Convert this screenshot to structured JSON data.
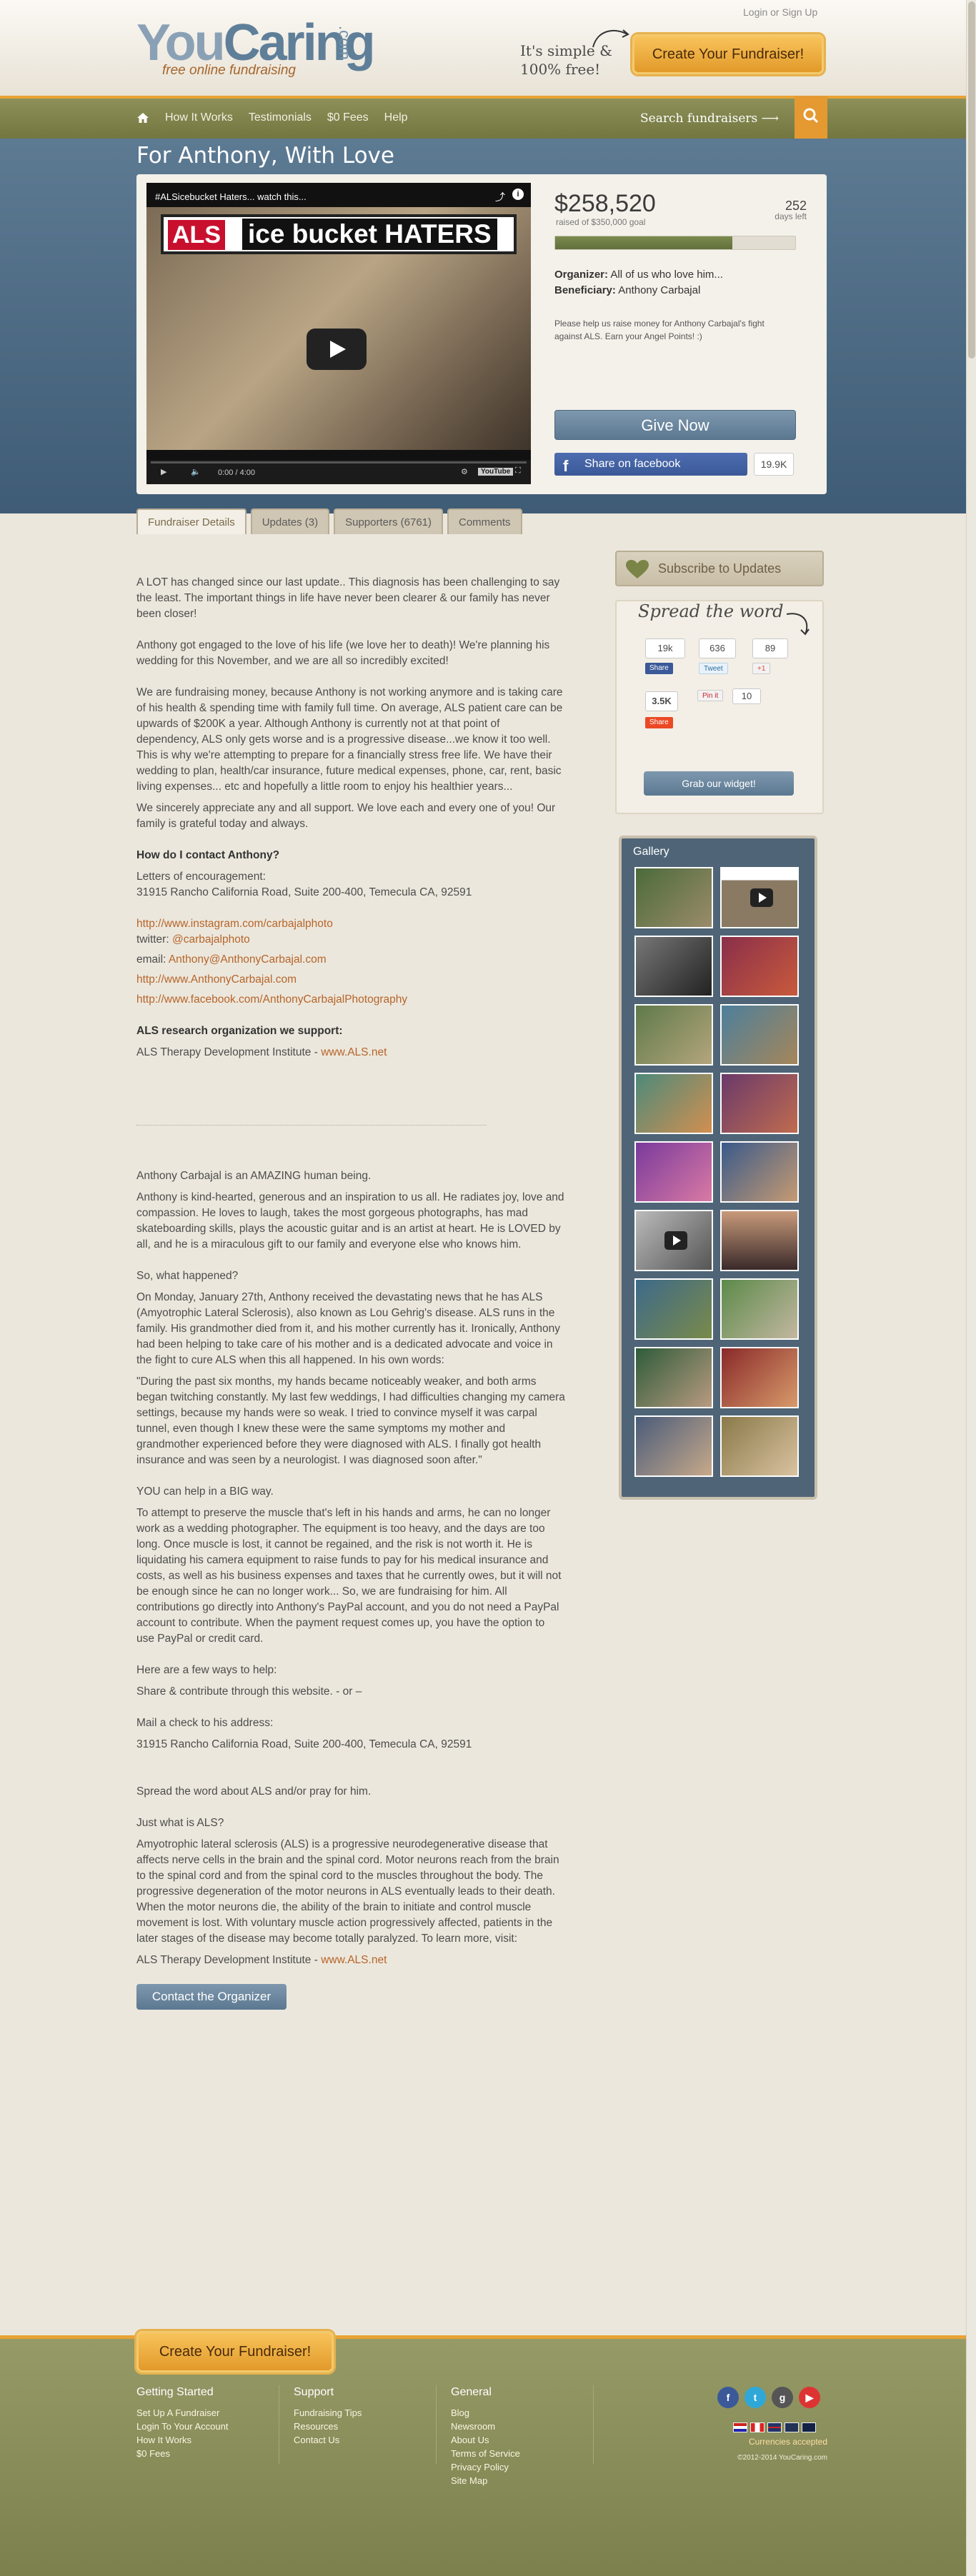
{
  "header": {
    "logo_text_a": "You",
    "logo_text_b": "Caring",
    "logo_com": ".com",
    "tagline": "free online fundraising",
    "login": "Login or Sign Up",
    "simple_text": "It's simple & 100% free!",
    "create_button": "Create Your Fundraiser!"
  },
  "nav": {
    "items": [
      "How It Works",
      "Testimonials",
      "$0 Fees",
      "Help"
    ],
    "search_label": "Search fundraisers"
  },
  "page_title": "For Anthony, With Love",
  "video": {
    "title": "#ALSicebucket Haters... watch this...",
    "banner_als": "ALS",
    "banner_text": "ice bucket HATERS",
    "time": "0:00 / 4:00"
  },
  "campaign": {
    "amount": "$258,520",
    "goal": "raised of $350,000 goal",
    "days": "252",
    "days_label": "days left",
    "progress": 0.7386,
    "organizer_label": "Organizer:",
    "organizer": "All of us who love him...",
    "beneficiary_label": "Beneficiary:",
    "beneficiary": "Anthony Carbajal",
    "description": "Please help us raise money for Anthony Carbajal's fight against ALS. Earn your Angel Points! :)",
    "give_now": "Give Now",
    "fb_share": "Share on facebook",
    "fb_count": "19.9K"
  },
  "tabs": [
    "Fundraiser Details",
    "Updates (3)",
    "Supporters (6761)",
    "Comments"
  ],
  "content": {
    "p1": "A LOT has changed since our last update.. This diagnosis has been challenging to say the least. The important things in life have never been clearer & our family has never been closer!",
    "p2": "Anthony got engaged to the love of his life (we love her to death)! We're planning his wedding for this November, and we are all so incredibly excited!",
    "p3": "We are fundraising money, because Anthony is not working anymore and is taking care of his health & spending time with family full time. On average, ALS patient care can be upwards of $200K a year. Although Anthony is currently not at that point of dependency, ALS only gets worse and is a progressive disease...we know it too well. This is why we're attempting to prepare for a financially stress free life. We have their wedding to plan, health/car insurance, future medical expenses, phone, car, rent, basic living expenses... etc and hopefully a little room to enjoy his healthier years...",
    "p4": "We sincerely appreciate any and all support. We love each and every one of you! Our family is grateful today and always.",
    "contact_heading": "How do I contact Anthony?",
    "letters": "Letters of encouragement:",
    "address": "31915 Rancho California Road, Suite 200-400, Temecula CA, 92591",
    "instagram": "http://www.instagram.com/carbajalphoto",
    "twitter_label": "twitter:",
    "twitter": "@carbajalphoto",
    "email_label": "email:",
    "email": "Anthony@AnthonyCarbajal.com",
    "website": "http://www.AnthonyCarbajal.com",
    "facebook": "http://www.facebook.com/AnthonyCarbajalPhotography",
    "research_heading": "ALS research organization we support:",
    "research_org": "ALS Therapy Development Institute - ",
    "research_link": "www.ALS.net",
    "amazing": "Anthony Carbajal is an AMAZING human being.",
    "kind": "Anthony is kind-hearted, generous and an inspiration to us all. He radiates joy, love and compassion. He loves to laugh, takes the most gorgeous photographs, has mad skateboarding skills, plays the acoustic guitar and is an artist at heart. He is LOVED by all, and he is a miraculous gift to our family and everyone else who knows him.",
    "what_happened": "So, what happened?",
    "monday": "On Monday, January 27th, Anthony received the devastating news that he has ALS (Amyotrophic Lateral Sclerosis), also known as Lou Gehrig's disease. ALS runs in the family. His grandmother died from it, and his mother currently has it. Ironically, Anthony had been helping to take care of his mother and is a dedicated advocate and voice in the fight to cure ALS when this all happened. In his own words:",
    "quote": " \"During the past six months, my hands became noticeably weaker, and both arms began twitching constantly. My last few weddings, I had difficulties changing my camera settings, because my hands were so weak. I tried to convince myself it was carpal tunnel, even though I knew these were the same symptoms my mother and grandmother experienced before they were diagnosed with ALS. I finally got health insurance and was seen by a neurologist. I was diagnosed soon after.\"",
    "you_help": "YOU can help in a BIG way.",
    "preserve": "To attempt to preserve the muscle that's left in his hands and arms, he can no longer work as a wedding photographer. The equipment is too heavy, and the days are too long. Once muscle is lost, it cannot be regained, and the risk is not worth it. He is liquidating his camera equipment to raise funds to pay for his medical insurance and costs, as well as his business expenses and taxes that he currently owes, but it will not be enough since he can no longer work... So, we are fundraising for him. All contributions go directly into Anthony's PayPal account, and you do not need a PayPal account to contribute. When the payment request comes up, you have the option to use PayPal or credit card.",
    "ways": "Here are a few ways to help:",
    "share": "Share & contribute through this website.  - or –",
    "mail": "Mail a check to his address:",
    "address2": "31915 Rancho California Road, Suite 200-400, Temecula CA, 92591",
    "spread_word": "Spread the word about ALS and/or pray for him.",
    "what_is": "Just what is ALS?",
    "als_desc": "Amyotrophic lateral sclerosis (ALS) is a progressive neurodegenerative disease that affects nerve cells in the brain and the spinal cord. Motor neurons reach from the brain to the spinal cord and from the spinal cord to the muscles throughout the body. The progressive degeneration of the motor neurons in ALS eventually leads to their death. When the motor neurons die, the ability of the brain to initiate and control muscle movement is lost. With voluntary muscle action progressively affected, patients in the later stages of the disease may become totally paralyzed. To learn more, visit:",
    "research_org2": "ALS Therapy Development Institute - ",
    "research_link2": "www.ALS.net",
    "contact_button": "Contact the Organizer"
  },
  "sidebar": {
    "subscribe": "Subscribe to Updates",
    "spread_title": "Spread the word",
    "counts": {
      "fb": "19k",
      "tweet": "636",
      "gplus": "89",
      "stumble": "3.5K",
      "pin": "10"
    },
    "labels": {
      "fb": "Share",
      "tweet": "Tweet",
      "gplus": "+1",
      "pin": "Pin it",
      "share": "Share"
    },
    "widget": "Grab our widget!",
    "gallery_title": "Gallery"
  },
  "footer": {
    "create_button": "Create Your Fundraiser!",
    "col1": {
      "title": "Getting Started",
      "links": [
        "Set Up A Fundraiser",
        "Login To Your Account",
        "How It Works",
        "$0 Fees"
      ]
    },
    "col2": {
      "title": "Support",
      "links": [
        "Fundraising Tips",
        "Resources",
        "Contact Us"
      ]
    },
    "col3": {
      "title": "General",
      "links": [
        "Blog",
        "Newsroom",
        "About Us",
        "Terms of Service",
        "Privacy Policy",
        "Site Map"
      ]
    },
    "currencies": "Currencies accepted",
    "copyright": "©2012-2014 YouCaring.com"
  },
  "colors": {
    "accent": "#e8a234",
    "nav": "#7f834a",
    "hero": "#4e6b85",
    "link": "#b5652b"
  }
}
